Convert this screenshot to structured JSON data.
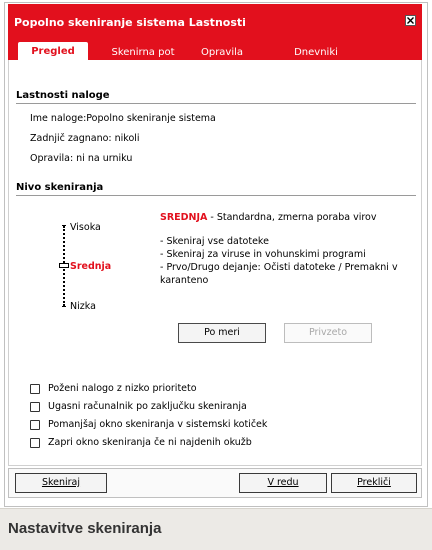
{
  "window": {
    "title": "Popolno skeniranje sistema Lastnosti",
    "accent_color": "#e2101d"
  },
  "tabs": [
    {
      "label": "Pregled",
      "active": true
    },
    {
      "label": "Skenirna pot",
      "active": false
    },
    {
      "label": "Opravila",
      "active": false
    },
    {
      "label": "Dnevniki",
      "active": false
    }
  ],
  "properties": {
    "heading": "Lastnosti naloge",
    "name_line": "Ime naloge:Popolno skeniranje sistema",
    "last_run_line": "Zadnjič zagnano: nikoli",
    "tasks_line": "Opravila: ni na urniku"
  },
  "scan_level": {
    "heading": "Nivo skeniranja",
    "levels": [
      "Visoka",
      "Srednja",
      "Nizka"
    ],
    "selected": "Srednja",
    "selected_title": "SREDNJA",
    "selected_desc": " - Standardna, zmerna poraba virov",
    "bullets": [
      "- Skeniraj vse datoteke",
      "- Skeniraj za viruse in vohunskimi programi",
      "- Prvo/Drugo dejanje: Očisti datoteke / Premakni v",
      "karanteno"
    ],
    "custom_button": "Po meri",
    "default_button": "Privzeto"
  },
  "options": [
    {
      "label": "Poženi nalogo z nizko prioriteto",
      "checked": false
    },
    {
      "label": "Ugasni računalnik po zaključku skeniranja",
      "checked": false
    },
    {
      "label": "Pomanjšaj okno skeniranja v sistemski kotiček",
      "checked": false
    },
    {
      "label": "Zapri okno skeniranja če ni najdenih okužb",
      "checked": false
    }
  ],
  "footer": {
    "scan_button": "Skeniraj",
    "ok_button": "V redu",
    "cancel_button": "Prekliči"
  },
  "caption": "Nastavitve skeniranja"
}
